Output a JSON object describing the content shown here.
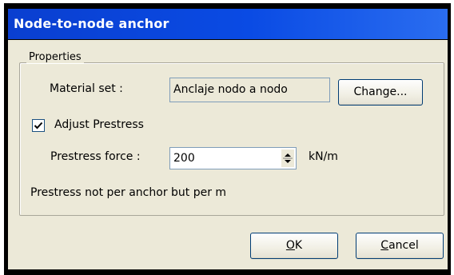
{
  "window": {
    "title": "Node-to-node anchor"
  },
  "properties": {
    "group_label": "Properties",
    "material_set_label": "Material set :",
    "material_set_value": "Anclaje nodo a nodo",
    "change_button": "Change...",
    "adjust_prestress_label": "Adjust Prestress",
    "adjust_prestress_checked": true,
    "prestress_force_label": "Prestress force :",
    "prestress_force_value": "200",
    "prestress_unit": "kN/m",
    "note": "Prestress not per anchor but per m"
  },
  "buttons": {
    "ok_mnemonic": "O",
    "ok_rest": "K",
    "cancel_mnemonic": "C",
    "cancel_rest": "ancel"
  },
  "colors": {
    "titlebar": "#0a4be4",
    "dialog_bg": "#ece9d8",
    "button_border": "#003c74"
  },
  "icons": {
    "checkbox": "checkmark-icon",
    "spinner": "spin-up-down-icon"
  }
}
